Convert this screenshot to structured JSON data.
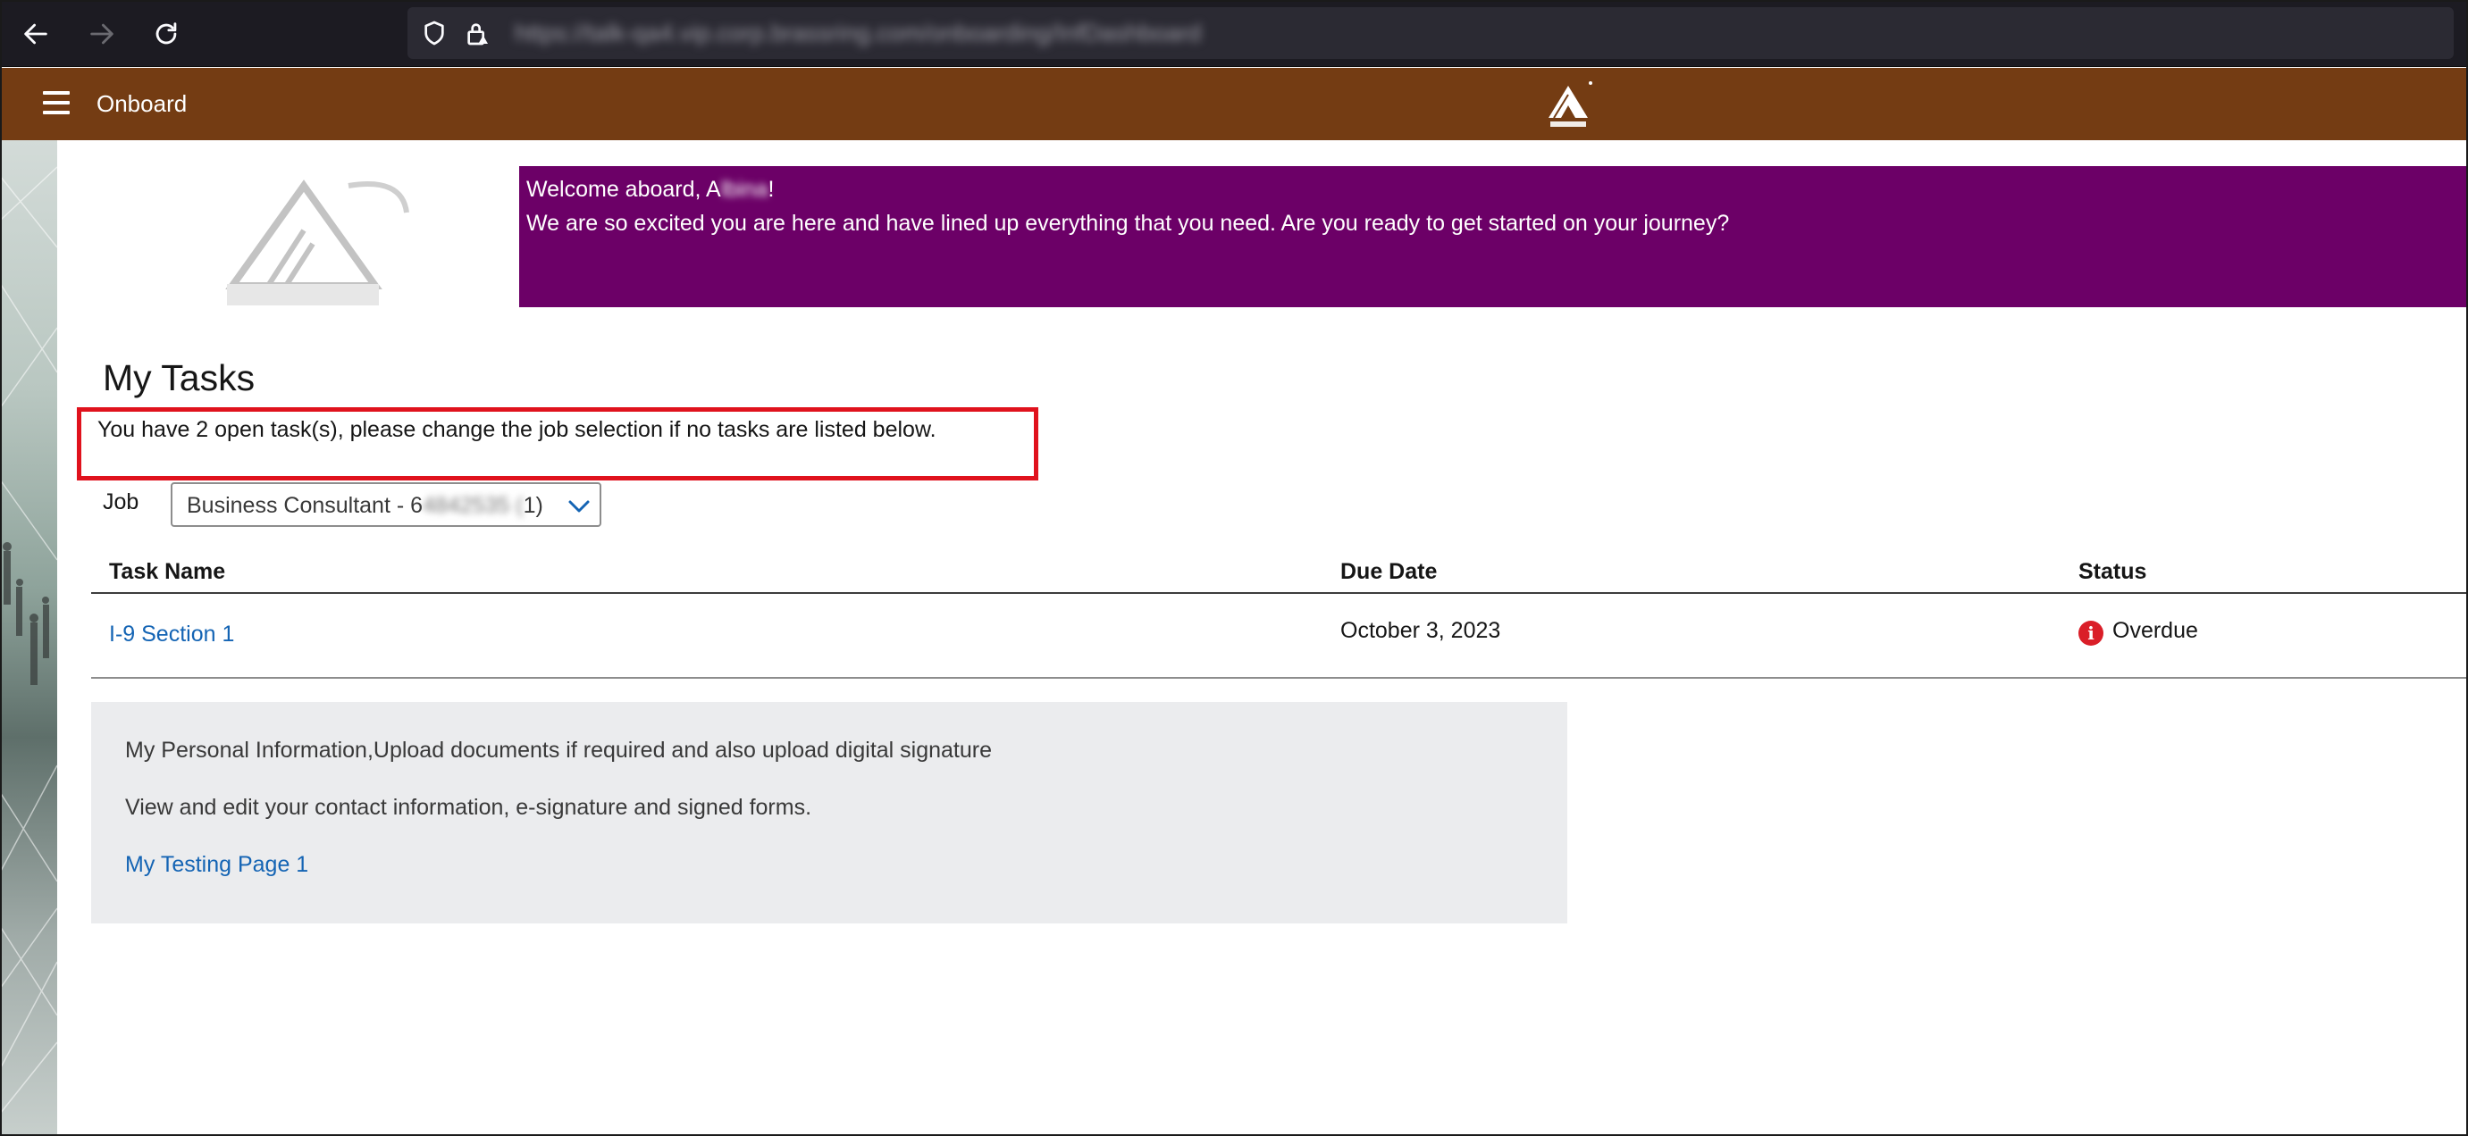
{
  "browser": {
    "url": "https://talk-qa4.vip.corp.brassring.com/onboarding/InfDashboard",
    "back_icon": "arrow-left-icon",
    "forward_icon": "arrow-right-icon",
    "reload_icon": "reload-icon",
    "shield_icon": "shield-icon",
    "lock_icon": "lock-warning-icon"
  },
  "header": {
    "menu_icon": "hamburger-icon",
    "title": "Onboard",
    "background": "#743c13"
  },
  "welcome": {
    "greeting_prefix": "Welcome aboard, A",
    "greeting_name_blurred": "lbina",
    "greeting_suffix": "!",
    "message": "We are so excited you are here and have lined up everything that you need. Are you ready to get started on your journey?",
    "background": "#6c0067"
  },
  "page": {
    "title": "My Tasks",
    "open_tasks_message": "You have 2 open task(s), please change the job selection if no tasks are listed below."
  },
  "job": {
    "label": "Job",
    "selected_prefix": "Business Consultant - 6",
    "selected_blurred": "4842535 (",
    "selected_suffix": "1)"
  },
  "table": {
    "columns": [
      "Task Name",
      "Due Date",
      "Status"
    ],
    "rows": [
      {
        "task_name": "I-9 Section 1",
        "due_date": "October 3, 2023",
        "status": "Overdue"
      }
    ],
    "status_icon_glyph": "i"
  },
  "info_card": {
    "line1": "My Personal Information,Upload documents if required and also upload digital signature",
    "line2": "View and edit your contact information, e-signature and signed forms.",
    "link": "My Testing Page 1"
  },
  "colors": {
    "link": "#1464b4",
    "overdue": "#da1e28",
    "highlight_box": "#e0121d",
    "card_background": "#ebecee"
  }
}
